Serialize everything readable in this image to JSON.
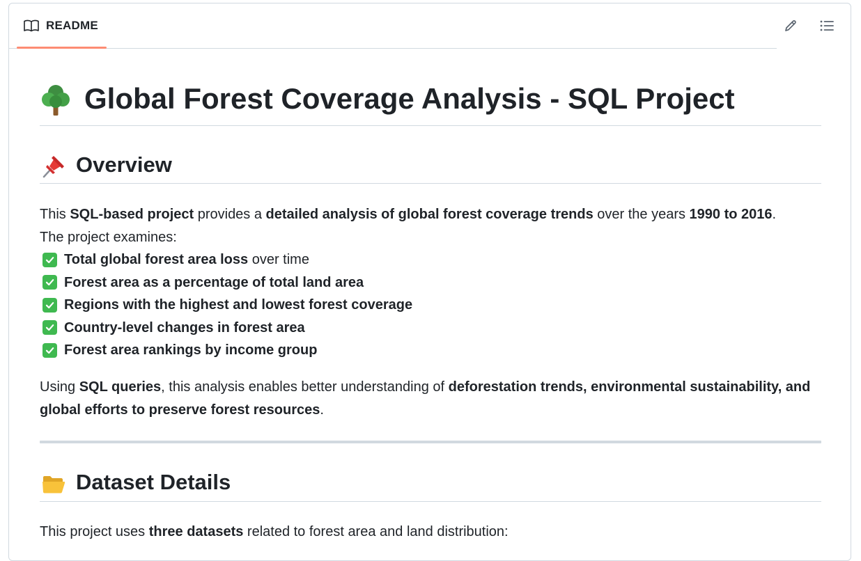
{
  "header": {
    "tab_label": "README",
    "icons": {
      "tab": "book-icon",
      "edit": "pencil-icon",
      "outline": "list-icon"
    }
  },
  "title": {
    "emoji": "tree-emoji",
    "text": "Global Forest Coverage Analysis - SQL Project"
  },
  "overview": {
    "emoji": "pushpin-emoji",
    "heading": "Overview",
    "intro": {
      "t1": "This ",
      "b1": "SQL-based project",
      "t2": " provides a ",
      "b2": "detailed analysis of global forest coverage trends",
      "t3": " over the years ",
      "b3": "1990 to 2016",
      "t4": ".",
      "line2": "The project examines:"
    },
    "checklist": [
      {
        "bold": "Total global forest area loss",
        "rest": " over time"
      },
      {
        "bold": "Forest area as a percentage of total land area",
        "rest": ""
      },
      {
        "bold": "Regions with the highest and lowest forest coverage",
        "rest": ""
      },
      {
        "bold": "Country-level changes in forest area",
        "rest": ""
      },
      {
        "bold": "Forest area rankings by income group",
        "rest": ""
      }
    ],
    "summary": {
      "t1": "Using ",
      "b1": "SQL queries",
      "t2": ", this analysis enables better understanding of ",
      "b2": "deforestation trends, environmental sustainability, and global efforts to preserve forest resources",
      "t3": "."
    }
  },
  "dataset": {
    "emoji": "open-folder-emoji",
    "heading": "Dataset Details",
    "intro": {
      "t1": "This project uses ",
      "b1": "three datasets",
      "t2": " related to forest area and land distribution:"
    }
  },
  "colors": {
    "text": "#1f2328",
    "border": "#d1d9e0",
    "tab_accent": "#fd8c73",
    "check_green": "#3fb950"
  }
}
